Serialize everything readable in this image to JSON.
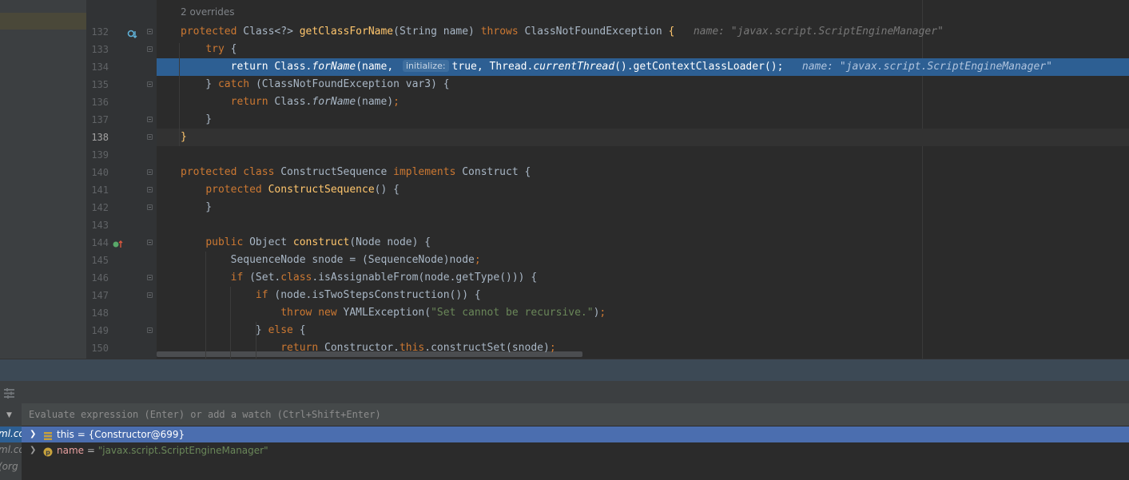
{
  "editor": {
    "overrides_hint": "2 overrides",
    "lines": [
      {
        "num": "132",
        "segs": [
          [
            "kw",
            "protected "
          ],
          [
            "",
            "Class<?> "
          ],
          [
            "fn",
            "getClassForName"
          ],
          [
            "",
            "(String name) "
          ],
          [
            "kw",
            "throws "
          ],
          [
            "",
            "ClassNotFoundException "
          ],
          [
            "fn",
            "{"
          ],
          [
            "hint",
            "   name: \"javax.script.ScriptEngineManager\""
          ]
        ]
      },
      {
        "num": "133",
        "segs": [
          [
            "",
            "    "
          ],
          [
            "kw",
            "try "
          ],
          [
            "",
            "{"
          ]
        ]
      },
      {
        "num": "134",
        "segs": [
          [
            "",
            "        "
          ],
          [
            "kw",
            "return "
          ],
          [
            "",
            "Class."
          ],
          [
            "it",
            "forName"
          ],
          [
            "",
            "(name, "
          ],
          [
            "pill",
            "initialize:"
          ],
          [
            "kw",
            "true"
          ],
          [
            "",
            ", Thread."
          ],
          [
            "it",
            "currentThread"
          ],
          [
            "",
            "().getContextClassLoader()"
          ],
          [
            "kw",
            ";"
          ],
          [
            "hint",
            "   name: \"javax.script.ScriptEngineManager\""
          ]
        ]
      },
      {
        "num": "135",
        "segs": [
          [
            "",
            "    } "
          ],
          [
            "kw",
            "catch "
          ],
          [
            "",
            "(ClassNotFoundException var3) {"
          ]
        ]
      },
      {
        "num": "136",
        "segs": [
          [
            "",
            "        "
          ],
          [
            "kw",
            "return "
          ],
          [
            "",
            "Class."
          ],
          [
            "it",
            "forName"
          ],
          [
            "",
            "(name)"
          ],
          [
            "kw",
            ";"
          ]
        ]
      },
      {
        "num": "137",
        "segs": [
          [
            "",
            "    }"
          ]
        ]
      },
      {
        "num": "138",
        "segs": [
          [
            "fn",
            "}"
          ]
        ]
      },
      {
        "num": "139",
        "segs": []
      },
      {
        "num": "140",
        "segs": [
          [
            "kw",
            "protected class "
          ],
          [
            "",
            "ConstructSequence "
          ],
          [
            "kw",
            "implements "
          ],
          [
            "",
            "Construct {"
          ]
        ]
      },
      {
        "num": "141",
        "segs": [
          [
            "",
            "    "
          ],
          [
            "kw",
            "protected "
          ],
          [
            "fn",
            "ConstructSequence"
          ],
          [
            "",
            "() {"
          ]
        ]
      },
      {
        "num": "142",
        "segs": [
          [
            "",
            "    }"
          ]
        ]
      },
      {
        "num": "143",
        "segs": []
      },
      {
        "num": "144",
        "segs": [
          [
            "",
            "    "
          ],
          [
            "kw",
            "public "
          ],
          [
            "",
            "Object "
          ],
          [
            "fn",
            "construct"
          ],
          [
            "",
            "(Node node) {"
          ]
        ]
      },
      {
        "num": "145",
        "segs": [
          [
            "",
            "        SequenceNode snode = (SequenceNode)node"
          ],
          [
            "kw",
            ";"
          ]
        ]
      },
      {
        "num": "146",
        "segs": [
          [
            "",
            "        "
          ],
          [
            "kw",
            "if "
          ],
          [
            "",
            "(Set."
          ],
          [
            "kw",
            "class"
          ],
          [
            "",
            ".isAssignableFrom(node.getType())) {"
          ]
        ]
      },
      {
        "num": "147",
        "segs": [
          [
            "",
            "            "
          ],
          [
            "kw",
            "if "
          ],
          [
            "",
            "(node.isTwoStepsConstruction()) {"
          ]
        ]
      },
      {
        "num": "148",
        "segs": [
          [
            "",
            "                "
          ],
          [
            "kw",
            "throw new "
          ],
          [
            "",
            "YAMLException("
          ],
          [
            "str",
            "\"Set cannot be recursive.\""
          ],
          [
            "",
            ")"
          ],
          [
            "kw",
            ";"
          ]
        ]
      },
      {
        "num": "149",
        "segs": [
          [
            "",
            "            } "
          ],
          [
            "kw",
            "else "
          ],
          [
            "",
            "{"
          ]
        ]
      },
      {
        "num": "150",
        "segs": [
          [
            "",
            "                "
          ],
          [
            "kw",
            "return "
          ],
          [
            "",
            "Constructor."
          ],
          [
            "kw",
            "this"
          ],
          [
            "",
            ".constructSet(snode)"
          ],
          [
            "kw",
            ";"
          ]
        ]
      }
    ]
  },
  "debugger": {
    "eval_placeholder": "Evaluate expression (Enter) or add a watch (Ctrl+Shift+Enter)",
    "left_fragments": [
      "ml.co",
      "ml.co",
      "(org"
    ],
    "variables": [
      {
        "name": "this",
        "value": "{Constructor@699}",
        "icon": "field-icon"
      },
      {
        "name": "name",
        "value": "\"javax.script.ScriptEngineManager\"",
        "icon": "parameter-icon"
      }
    ]
  },
  "colors": {
    "breakpoint_line": "#2d5f93",
    "keyword": "#cc7832",
    "method": "#ffc66d",
    "string": "#6a8759",
    "selected_variable": "#4b6eaf"
  }
}
